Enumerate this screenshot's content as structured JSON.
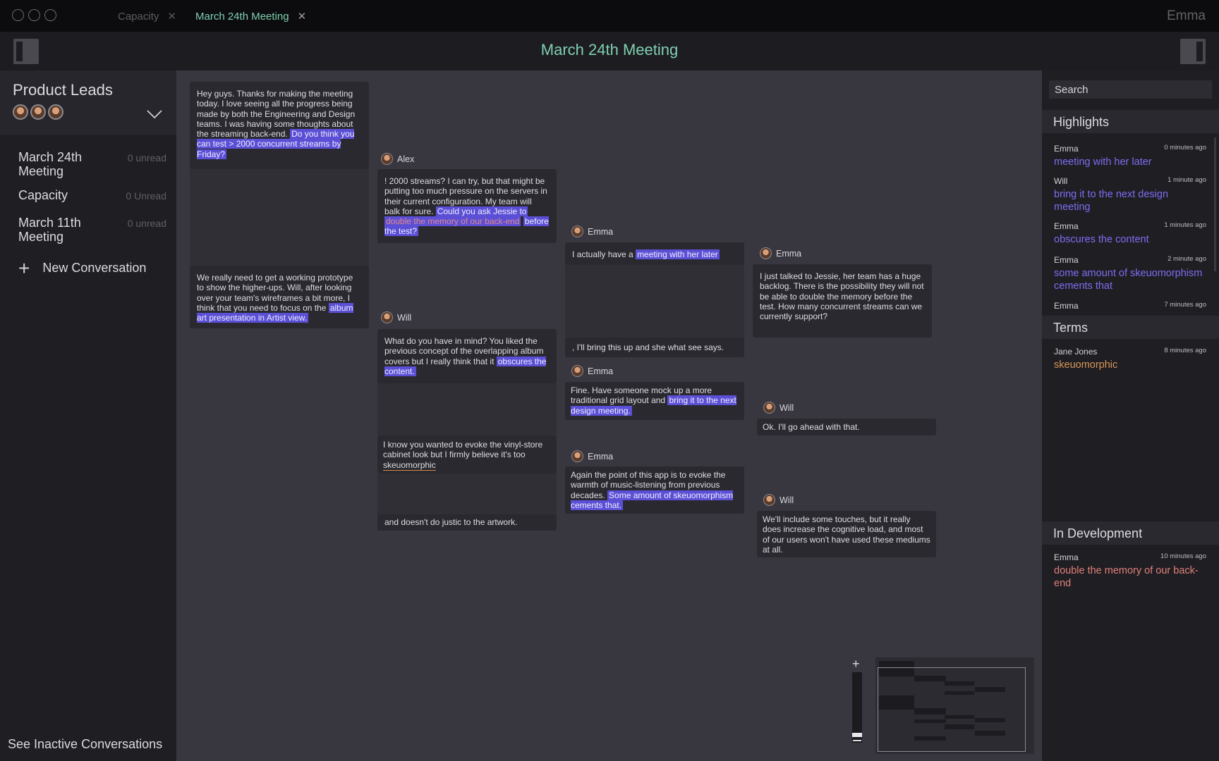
{
  "tabs": [
    {
      "label": "Capacity",
      "active": false
    },
    {
      "label": "March 24th Meeting",
      "active": true
    }
  ],
  "user": {
    "name": "Emma"
  },
  "header": {
    "title": "March 24th Meeting"
  },
  "sidebar": {
    "group_title": "Product Leads",
    "conversations": [
      {
        "label": "March 24th Meeting",
        "count": "0 unread"
      },
      {
        "label": "Capacity",
        "count": "0 Unread"
      },
      {
        "label": "March 11th Meeting",
        "count": "0 unread"
      }
    ],
    "new_conversation": "New Conversation",
    "inactive_link": "See Inactive Conversations"
  },
  "canvas": {
    "m1": {
      "pre": "Hey guys. Thanks for making the meeting today. I love seeing all the progress being made by both the Engineering and Design teams. I was having some thoughts about the streaming back-end.",
      "hl": "Do you think you can test > 2000 concurrent streams by Friday?"
    },
    "m2": {
      "pre": "We really need to get a working prototype to show the higher-ups. Will, after looking over your team's wireframes a bit more, I think that you need to focus on the",
      "hl": "album art presentation in Artist view."
    },
    "alex": {
      "name": "Alex",
      "pre": "! 2000 streams? I can try, but that might be putting too much pressure on the servers in their current configuration. My team will balk for sure.",
      "hl1": "Could you ask Jessie to",
      "hl_red": "double the memory of our back-end",
      "hl2": "before the test?"
    },
    "will1": {
      "name": "Will",
      "pre": "What do you have in mind? You liked the previous concept of the overlapping album covers but I really think that it",
      "hl": "obscures the content."
    },
    "will1b": {
      "pre": "I know you wanted to evoke the vinyl-store cabinet look but I firmly believe it's too",
      "term": "skeuomorphic"
    },
    "will1c": {
      "text": "and doesn't do justic to the artwork."
    },
    "emma1": {
      "name": "Emma",
      "pre": "I actually have a",
      "hl": "meeting with her later"
    },
    "emma1b": {
      "text": ", I'll bring this up and she what see says."
    },
    "emma2": {
      "name": "Emma",
      "pre": "Fine. Have someone mock up a more traditional grid layout and",
      "hl": "bring it to the next design meeting."
    },
    "emma3": {
      "name": "Emma",
      "pre": "Again the point of this app is to evoke the warmth of music-listening from previous decades.",
      "hl": "Some amount of skeuomorphism cements that."
    },
    "emma4": {
      "name": "Emma",
      "text": "I just talked to Jessie, her team has a huge backlog. There is the possibility they will not be able to double the memory before the test. How many concurrent streams can we currently support?"
    },
    "will2": {
      "name": "Will",
      "text": "Ok. I'll go ahead with that."
    },
    "will3": {
      "name": "Will",
      "text": "We'll include some touches, but it really does increase the cognitive load, and most of our users won't have used these mediums at all."
    }
  },
  "right_panel": {
    "search_placeholder": "Search",
    "highlights_title": "Highlights",
    "highlights": [
      {
        "author": "Emma",
        "time": "0 minutes ago",
        "text": "meeting with her later"
      },
      {
        "author": "Will",
        "time": "1 minute ago",
        "text": "bring it to the next design meeting"
      },
      {
        "author": "Emma",
        "time": "1 minutes ago",
        "text": "obscures the content"
      },
      {
        "author": "Emma",
        "time": "2 minute ago",
        "text": "some amount of skeuomorphism cements that"
      },
      {
        "author": "Emma",
        "time": "7 minutes ago",
        "text": ""
      }
    ],
    "terms_title": "Terms",
    "terms": [
      {
        "author": "Jane Jones",
        "time": "8 minutes ago",
        "text": "skeuomorphic"
      }
    ],
    "dev_title": "In Development",
    "dev": [
      {
        "author": "Emma",
        "time": "10 minutes ago",
        "text": "double the memory of our back-end"
      }
    ]
  },
  "colors": {
    "accent": "#7fd0b0",
    "highlight": "#5b4fd6",
    "purple_text": "#7d6ef0",
    "orange_text": "#d99658",
    "salmon_text": "#e0807a"
  }
}
